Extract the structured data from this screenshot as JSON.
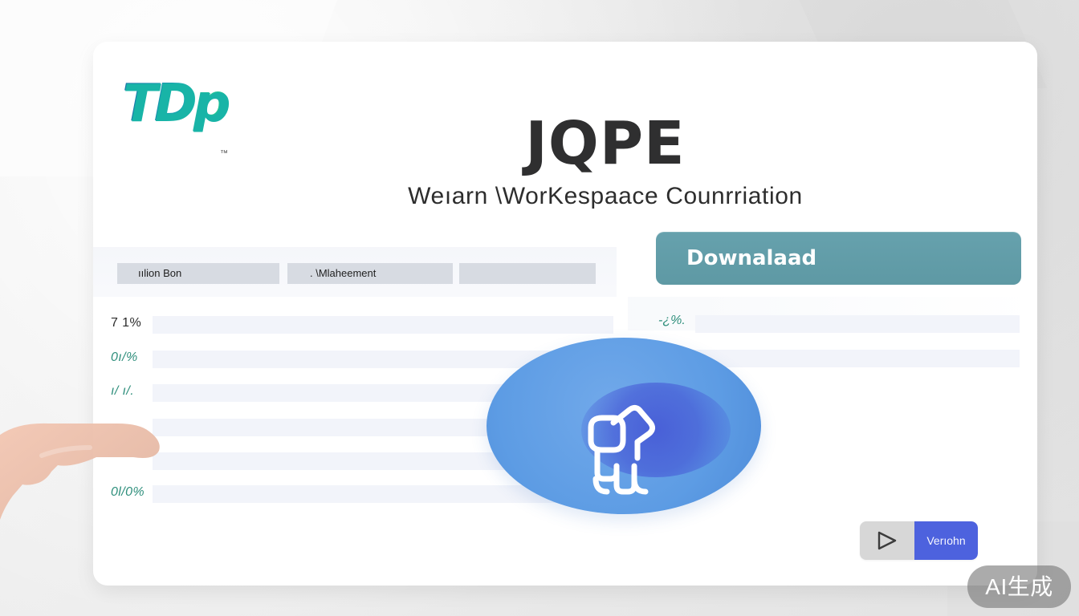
{
  "brand": {
    "logo_text": "TDp",
    "logo_mark": "™",
    "title": "JQPE",
    "subtitle": "Weıarn \\WorKespaace Counrriation"
  },
  "tabs": [
    {
      "label": "ıılion Bon"
    },
    {
      "label": ". \\Mlaheement"
    },
    {
      "label": ""
    }
  ],
  "cta": {
    "label": "Downalaad"
  },
  "stats": {
    "left_rows": [
      {
        "label": "7 1%"
      },
      {
        "label": "0ı/% "
      },
      {
        "label": "ı/ ı/."
      },
      {
        "label": ""
      },
      {
        "label": ""
      },
      {
        "label": "0l/0%"
      }
    ],
    "right_label": "-¿%."
  },
  "player": {
    "version_label": "Verıohn"
  },
  "watermark": {
    "label": "AI生成"
  },
  "icons": {
    "hero": "robot-icon",
    "play": "play-icon",
    "hand": "hand-icon",
    "logo": "tdp-logo"
  },
  "colors": {
    "download": "#659FAA",
    "hero": "#5E9CE4",
    "hero_shadow": "#4D62DE",
    "version": "#4D62DE",
    "logo_start": "#1A6EA8",
    "logo_end": "#25CC8E"
  }
}
